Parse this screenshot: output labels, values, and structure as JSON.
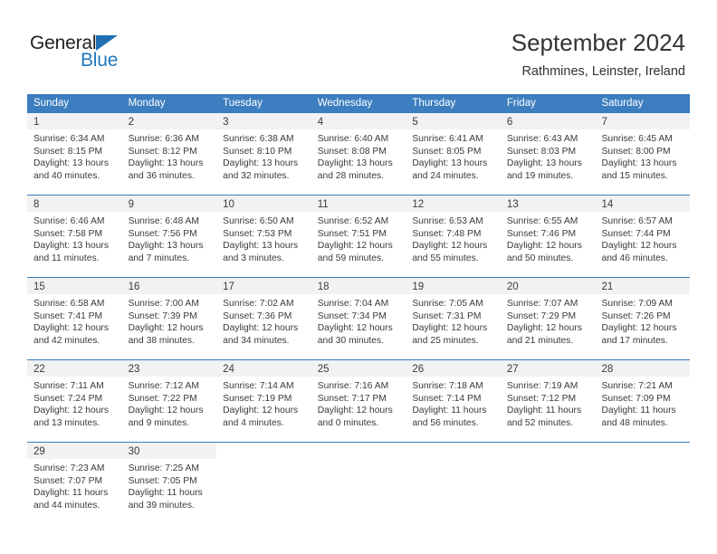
{
  "brand": {
    "name_part1": "General",
    "name_part2": "Blue",
    "primary_color": "#1f78bd",
    "header_color": "#3c7ebf",
    "triangle_icon": "triangle-icon"
  },
  "header": {
    "title": "September 2024",
    "subtitle": "Rathmines, Leinster, Ireland"
  },
  "calendar": {
    "weekdays": [
      "Sunday",
      "Monday",
      "Tuesday",
      "Wednesday",
      "Thursday",
      "Friday",
      "Saturday"
    ],
    "weeks": [
      [
        {
          "day": "1",
          "sunrise": "Sunrise: 6:34 AM",
          "sunset": "Sunset: 8:15 PM",
          "daylight_1": "Daylight: 13 hours",
          "daylight_2": "and 40 minutes."
        },
        {
          "day": "2",
          "sunrise": "Sunrise: 6:36 AM",
          "sunset": "Sunset: 8:12 PM",
          "daylight_1": "Daylight: 13 hours",
          "daylight_2": "and 36 minutes."
        },
        {
          "day": "3",
          "sunrise": "Sunrise: 6:38 AM",
          "sunset": "Sunset: 8:10 PM",
          "daylight_1": "Daylight: 13 hours",
          "daylight_2": "and 32 minutes."
        },
        {
          "day": "4",
          "sunrise": "Sunrise: 6:40 AM",
          "sunset": "Sunset: 8:08 PM",
          "daylight_1": "Daylight: 13 hours",
          "daylight_2": "and 28 minutes."
        },
        {
          "day": "5",
          "sunrise": "Sunrise: 6:41 AM",
          "sunset": "Sunset: 8:05 PM",
          "daylight_1": "Daylight: 13 hours",
          "daylight_2": "and 24 minutes."
        },
        {
          "day": "6",
          "sunrise": "Sunrise: 6:43 AM",
          "sunset": "Sunset: 8:03 PM",
          "daylight_1": "Daylight: 13 hours",
          "daylight_2": "and 19 minutes."
        },
        {
          "day": "7",
          "sunrise": "Sunrise: 6:45 AM",
          "sunset": "Sunset: 8:00 PM",
          "daylight_1": "Daylight: 13 hours",
          "daylight_2": "and 15 minutes."
        }
      ],
      [
        {
          "day": "8",
          "sunrise": "Sunrise: 6:46 AM",
          "sunset": "Sunset: 7:58 PM",
          "daylight_1": "Daylight: 13 hours",
          "daylight_2": "and 11 minutes."
        },
        {
          "day": "9",
          "sunrise": "Sunrise: 6:48 AM",
          "sunset": "Sunset: 7:56 PM",
          "daylight_1": "Daylight: 13 hours",
          "daylight_2": "and 7 minutes."
        },
        {
          "day": "10",
          "sunrise": "Sunrise: 6:50 AM",
          "sunset": "Sunset: 7:53 PM",
          "daylight_1": "Daylight: 13 hours",
          "daylight_2": "and 3 minutes."
        },
        {
          "day": "11",
          "sunrise": "Sunrise: 6:52 AM",
          "sunset": "Sunset: 7:51 PM",
          "daylight_1": "Daylight: 12 hours",
          "daylight_2": "and 59 minutes."
        },
        {
          "day": "12",
          "sunrise": "Sunrise: 6:53 AM",
          "sunset": "Sunset: 7:48 PM",
          "daylight_1": "Daylight: 12 hours",
          "daylight_2": "and 55 minutes."
        },
        {
          "day": "13",
          "sunrise": "Sunrise: 6:55 AM",
          "sunset": "Sunset: 7:46 PM",
          "daylight_1": "Daylight: 12 hours",
          "daylight_2": "and 50 minutes."
        },
        {
          "day": "14",
          "sunrise": "Sunrise: 6:57 AM",
          "sunset": "Sunset: 7:44 PM",
          "daylight_1": "Daylight: 12 hours",
          "daylight_2": "and 46 minutes."
        }
      ],
      [
        {
          "day": "15",
          "sunrise": "Sunrise: 6:58 AM",
          "sunset": "Sunset: 7:41 PM",
          "daylight_1": "Daylight: 12 hours",
          "daylight_2": "and 42 minutes."
        },
        {
          "day": "16",
          "sunrise": "Sunrise: 7:00 AM",
          "sunset": "Sunset: 7:39 PM",
          "daylight_1": "Daylight: 12 hours",
          "daylight_2": "and 38 minutes."
        },
        {
          "day": "17",
          "sunrise": "Sunrise: 7:02 AM",
          "sunset": "Sunset: 7:36 PM",
          "daylight_1": "Daylight: 12 hours",
          "daylight_2": "and 34 minutes."
        },
        {
          "day": "18",
          "sunrise": "Sunrise: 7:04 AM",
          "sunset": "Sunset: 7:34 PM",
          "daylight_1": "Daylight: 12 hours",
          "daylight_2": "and 30 minutes."
        },
        {
          "day": "19",
          "sunrise": "Sunrise: 7:05 AM",
          "sunset": "Sunset: 7:31 PM",
          "daylight_1": "Daylight: 12 hours",
          "daylight_2": "and 25 minutes."
        },
        {
          "day": "20",
          "sunrise": "Sunrise: 7:07 AM",
          "sunset": "Sunset: 7:29 PM",
          "daylight_1": "Daylight: 12 hours",
          "daylight_2": "and 21 minutes."
        },
        {
          "day": "21",
          "sunrise": "Sunrise: 7:09 AM",
          "sunset": "Sunset: 7:26 PM",
          "daylight_1": "Daylight: 12 hours",
          "daylight_2": "and 17 minutes."
        }
      ],
      [
        {
          "day": "22",
          "sunrise": "Sunrise: 7:11 AM",
          "sunset": "Sunset: 7:24 PM",
          "daylight_1": "Daylight: 12 hours",
          "daylight_2": "and 13 minutes."
        },
        {
          "day": "23",
          "sunrise": "Sunrise: 7:12 AM",
          "sunset": "Sunset: 7:22 PM",
          "daylight_1": "Daylight: 12 hours",
          "daylight_2": "and 9 minutes."
        },
        {
          "day": "24",
          "sunrise": "Sunrise: 7:14 AM",
          "sunset": "Sunset: 7:19 PM",
          "daylight_1": "Daylight: 12 hours",
          "daylight_2": "and 4 minutes."
        },
        {
          "day": "25",
          "sunrise": "Sunrise: 7:16 AM",
          "sunset": "Sunset: 7:17 PM",
          "daylight_1": "Daylight: 12 hours",
          "daylight_2": "and 0 minutes."
        },
        {
          "day": "26",
          "sunrise": "Sunrise: 7:18 AM",
          "sunset": "Sunset: 7:14 PM",
          "daylight_1": "Daylight: 11 hours",
          "daylight_2": "and 56 minutes."
        },
        {
          "day": "27",
          "sunrise": "Sunrise: 7:19 AM",
          "sunset": "Sunset: 7:12 PM",
          "daylight_1": "Daylight: 11 hours",
          "daylight_2": "and 52 minutes."
        },
        {
          "day": "28",
          "sunrise": "Sunrise: 7:21 AM",
          "sunset": "Sunset: 7:09 PM",
          "daylight_1": "Daylight: 11 hours",
          "daylight_2": "and 48 minutes."
        }
      ],
      [
        {
          "day": "29",
          "sunrise": "Sunrise: 7:23 AM",
          "sunset": "Sunset: 7:07 PM",
          "daylight_1": "Daylight: 11 hours",
          "daylight_2": "and 44 minutes."
        },
        {
          "day": "30",
          "sunrise": "Sunrise: 7:25 AM",
          "sunset": "Sunset: 7:05 PM",
          "daylight_1": "Daylight: 11 hours",
          "daylight_2": "and 39 minutes."
        },
        {
          "day": "",
          "sunrise": "",
          "sunset": "",
          "daylight_1": "",
          "daylight_2": ""
        },
        {
          "day": "",
          "sunrise": "",
          "sunset": "",
          "daylight_1": "",
          "daylight_2": ""
        },
        {
          "day": "",
          "sunrise": "",
          "sunset": "",
          "daylight_1": "",
          "daylight_2": ""
        },
        {
          "day": "",
          "sunrise": "",
          "sunset": "",
          "daylight_1": "",
          "daylight_2": ""
        },
        {
          "day": "",
          "sunrise": "",
          "sunset": "",
          "daylight_1": "",
          "daylight_2": ""
        }
      ]
    ]
  }
}
